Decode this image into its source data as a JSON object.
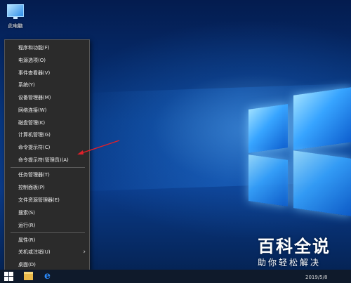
{
  "desktop": {
    "icon_label": "此电脑"
  },
  "menu": {
    "items": [
      {
        "label": "程序和功能(F)"
      },
      {
        "label": "电源选项(O)"
      },
      {
        "label": "事件查看器(V)"
      },
      {
        "label": "系统(Y)"
      },
      {
        "label": "设备管理器(M)"
      },
      {
        "label": "网络连接(W)"
      },
      {
        "label": "磁盘管理(K)"
      },
      {
        "label": "计算机管理(G)"
      },
      {
        "label": "命令提示符(C)"
      },
      {
        "label": "命令提示符(管理员)(A)"
      },
      {
        "label": "任务管理器(T)"
      },
      {
        "label": "控制面板(P)"
      },
      {
        "label": "文件资源管理器(E)"
      },
      {
        "label": "搜索(S)"
      },
      {
        "label": "运行(R)"
      },
      {
        "label": "属性(R)"
      },
      {
        "label": "关机或注销(U)"
      },
      {
        "label": "桌面(D)"
      }
    ],
    "submenu_glyph": "›"
  },
  "taskbar": {
    "date": "2019/5/8"
  },
  "watermark": {
    "title": "百科全说",
    "subtitle": "助你轻松解决"
  },
  "colors": {
    "menu_bg": "#2b2b2b",
    "arrow": "#e0202a",
    "taskbar": "#0f1a2b"
  }
}
